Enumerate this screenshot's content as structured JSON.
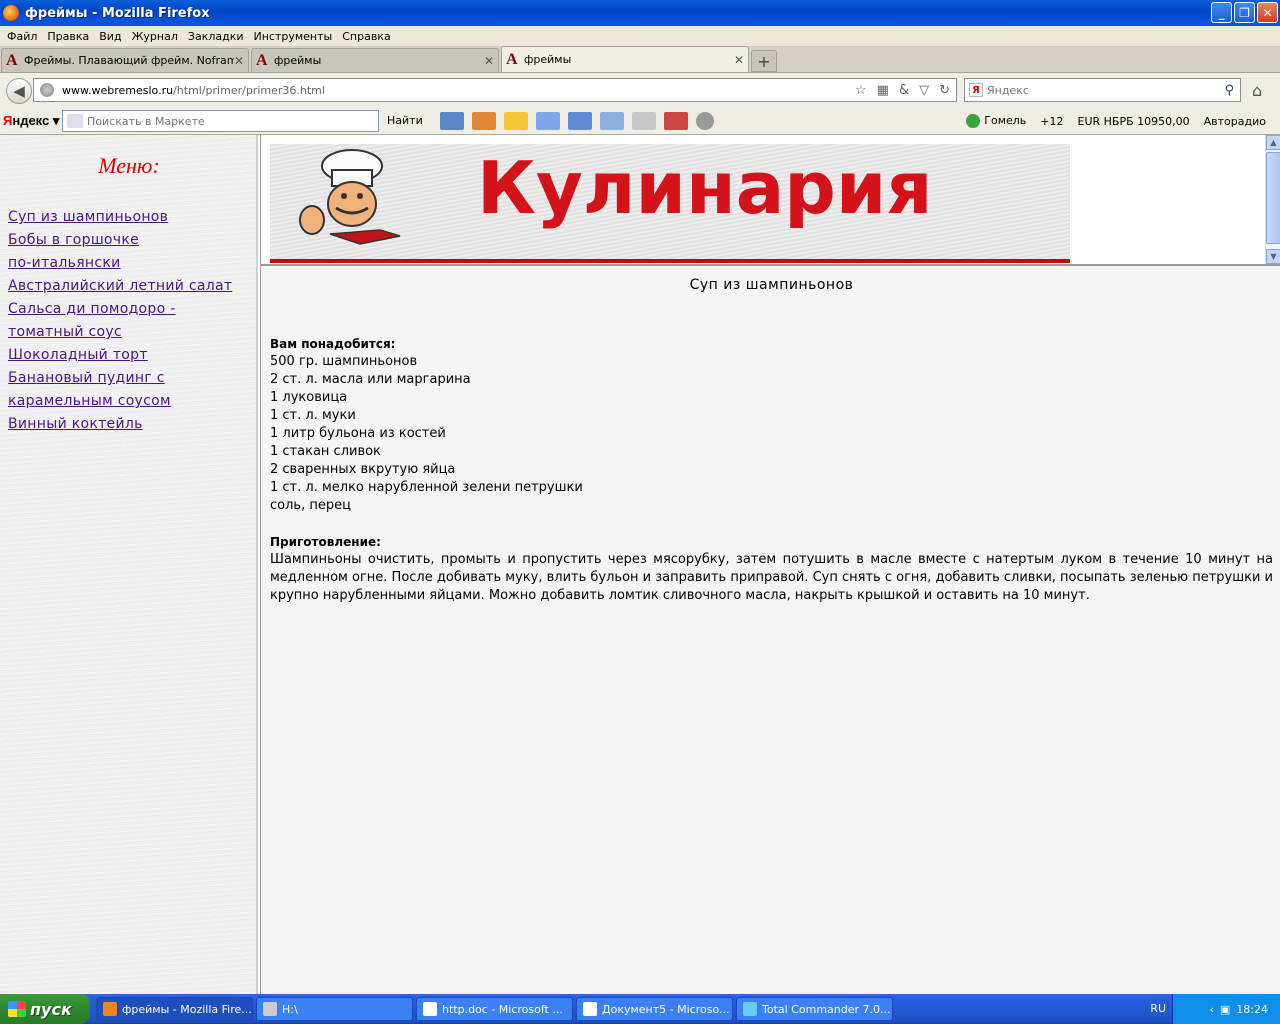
{
  "window": {
    "title": "фреймы - Mozilla Firefox",
    "controls": [
      "_",
      "❐",
      "✕"
    ]
  },
  "menubar": [
    "Файл",
    "Правка",
    "Вид",
    "Журнал",
    "Закладки",
    "Инструменты",
    "Справка"
  ],
  "tabs": [
    {
      "label": "Фреймы. Плавающий фрейм. Noframes...",
      "active": false
    },
    {
      "label": "фреймы",
      "active": false
    },
    {
      "label": "фреймы",
      "active": true
    }
  ],
  "tab_close": "✕",
  "new_tab": "+",
  "favicon_glyph": "A",
  "navbar": {
    "url_host": "www.webremeslo.ru",
    "url_path": "/html/primer/primer36.html",
    "search_placeholder": "Яндекс",
    "search_logo": "Я"
  },
  "yandex_bar": {
    "logo_first": "Я",
    "logo_rest": "ндекс",
    "search_placeholder": "Поискать в Маркете",
    "find_label": "Найти",
    "city": "Гомель",
    "temp": "+12",
    "currency": "EUR НБРБ 10950,00",
    "radio": "Авторадио"
  },
  "left_frame": {
    "menu_title": "Меню:",
    "items": [
      "Суп из шампиньонов",
      "Бобы в горшочке",
      "по-итальянски",
      "Австралийский летний салат",
      "Сальса ди помодоро -",
      "томатный соус",
      "Шоколадный торт",
      "Банановый пудинг с",
      "карамельным соусом",
      "Винный коктейль"
    ]
  },
  "banner": {
    "title": "Кулинария"
  },
  "article": {
    "heading": "Суп из шампиньонов",
    "ingredients_header": "Вам понадобится:",
    "ingredients": [
      "500 гр. шампиньонов",
      "2 ст. л. масла или маргарина",
      "1 луковица",
      "1 ст. л. муки",
      "1 литр бульона из костей",
      "1 стакан сливок",
      "2 сваренных вкрутую яйца",
      "1 ст. л. мелко нарубленной зелени петрушки",
      "соль, перец"
    ],
    "preparation_header": "Приготовление:",
    "preparation": "Шампиньоны очистить, промыть и пропустить через мясорубку, затем потушить в масле вместе с натертым луком в течение 10 минут на медленном огне. После добивать муку, влить бульон и заправить приправой. Суп снять с огня, добавить сливки, посыпать зеленью петрушки и крупно нарубленными яйцами. Можно добавить ломтик сливочного масла, накрыть крышкой и оставить на 10 минут."
  },
  "taskbar": {
    "start": "пуск",
    "items": [
      "фреймы - Mozilla Fire...",
      "H:\\",
      "http.doc - Microsoft ...",
      "Документ5 - Microso...",
      "Total Commander 7.0..."
    ],
    "lang": "RU",
    "time": "18:24"
  }
}
